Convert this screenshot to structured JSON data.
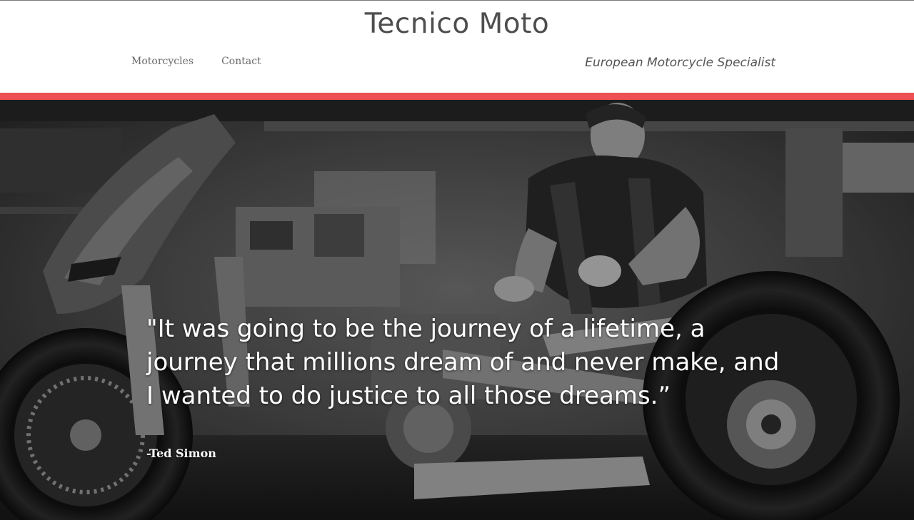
{
  "site": {
    "title": "Tecnico Moto",
    "tagline": "European Motorcycle Specialist"
  },
  "nav": {
    "items": [
      "Motorcycles",
      "Contact"
    ]
  },
  "hero": {
    "quote": "\"It was going to be the journey of a lifetime, a journey that millions dream of and never make, and I wanted to do justice to all those dreams.”",
    "author": "-Ted Simon",
    "image_description_icon": "mechanic-motorcycle-photo"
  },
  "colors": {
    "accent": "#ee5153",
    "title_text": "#4e4e4e",
    "nav_text": "#6a6a6a"
  }
}
